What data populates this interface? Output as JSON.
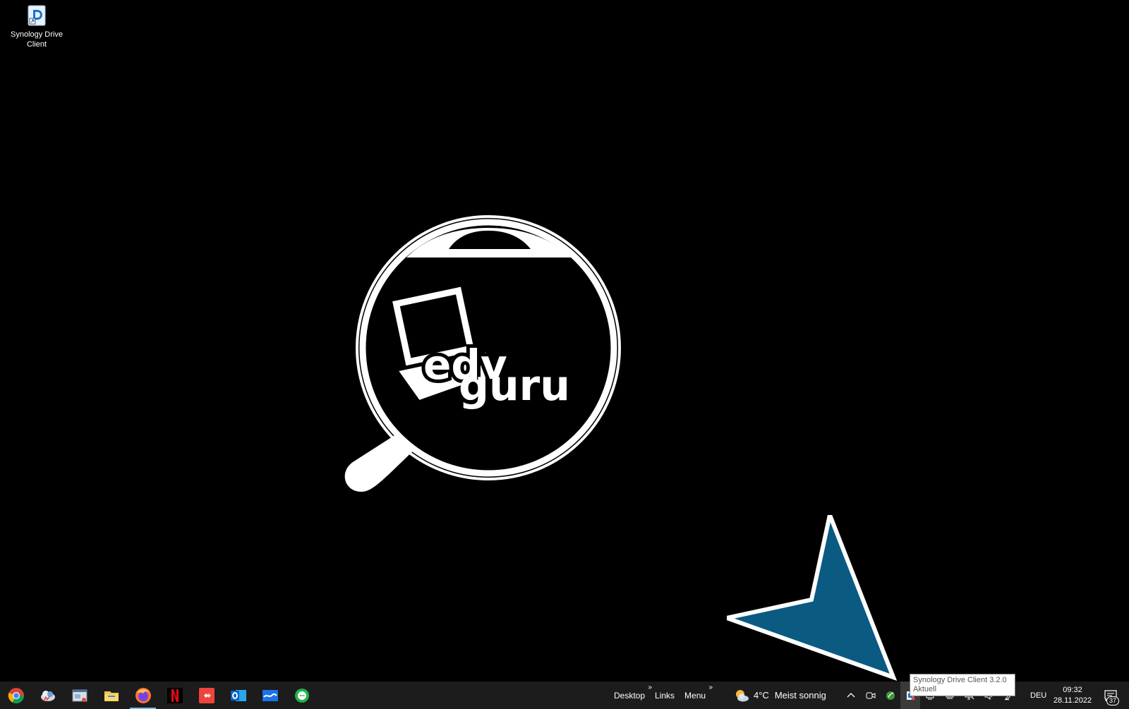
{
  "desktop": {
    "icons": [
      {
        "label": "Synology Drive Client",
        "icon": "synology-drive-icon"
      }
    ],
    "wallpaper_logo": {
      "text_top": "edv",
      "text_bottom": "guru",
      "icon": "magnifier-laptop-logo"
    }
  },
  "tooltip": {
    "line1": "Synology Drive Client 3.2.0",
    "line2": "Aktuell"
  },
  "taskbar": {
    "pinned_apps": [
      {
        "name": "Google Chrome",
        "icon": "chrome-icon",
        "color": "#4285f4"
      },
      {
        "name": "Cloud app",
        "icon": "cloud-icon",
        "color": "#6aa0d8"
      },
      {
        "name": "Remote desktop",
        "icon": "window-icon",
        "color": "#9aa7b5"
      },
      {
        "name": "File Explorer",
        "icon": "folder-icon",
        "color": "#f8c54a"
      },
      {
        "name": "Firefox",
        "icon": "firefox-icon",
        "color": "#ff7139",
        "active": true
      },
      {
        "name": "Netflix",
        "icon": "netflix-icon",
        "color": "#e50914"
      },
      {
        "name": "AnyDesk",
        "icon": "anydesk-icon",
        "color": "#ef443b"
      },
      {
        "name": "Outlook",
        "icon": "outlook-icon",
        "color": "#0a64c8"
      },
      {
        "name": "Mail",
        "icon": "mail-icon",
        "color": "#1a73e8"
      },
      {
        "name": "Messenger",
        "icon": "chat-icon",
        "color": "#22b14c"
      }
    ],
    "toolbars": [
      {
        "label": "Desktop",
        "chevron": "»"
      },
      {
        "label": "Links",
        "chevron": ""
      },
      {
        "label": "Menu",
        "chevron": "»"
      }
    ],
    "weather": {
      "temp": "4°C",
      "condition": "Meist sonnig",
      "icon": "sun-cloud-icon"
    },
    "tray_icons": [
      {
        "icon": "chevron-up-icon",
        "glyph": "^"
      },
      {
        "icon": "meet-now-icon",
        "glyph": "▢"
      },
      {
        "icon": "leaf-icon",
        "glyph": "●"
      },
      {
        "icon": "synology-tray-icon",
        "glyph": "■",
        "hover": true
      },
      {
        "icon": "network-icon",
        "glyph": "≡"
      },
      {
        "icon": "display-icon",
        "glyph": "▭"
      },
      {
        "icon": "monitor-icon",
        "glyph": "▭"
      },
      {
        "icon": "speaker-icon",
        "glyph": "♪"
      },
      {
        "icon": "pen-icon",
        "glyph": "✎"
      }
    ],
    "language": "DEU",
    "time": "09:32",
    "date": "28.11.2022",
    "notifications": {
      "count": "37",
      "icon": "action-center-icon"
    }
  },
  "colors": {
    "taskbar_bg": "#1c1c1c",
    "arrow_fill": "#0a5a82",
    "active_indicator": "#76b9ed"
  }
}
